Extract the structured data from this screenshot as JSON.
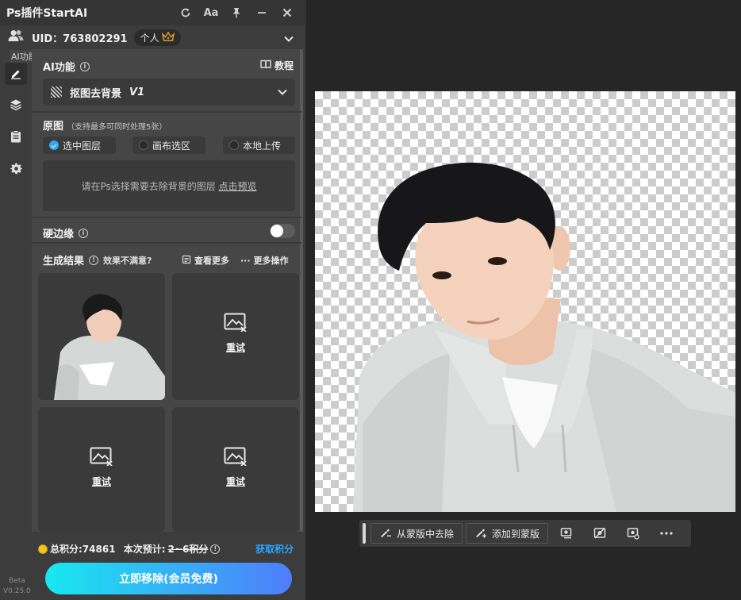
{
  "titlebar": {
    "title": "Ps插件StartAI",
    "icons": [
      "refresh-icon",
      "font-size-icon",
      "pin-icon",
      "minimize-icon",
      "close-icon"
    ],
    "font_label": "Aa"
  },
  "user": {
    "uid_label": "UID：763802291",
    "plan": "个人"
  },
  "sidebar": {
    "tooltip": "AI功能",
    "items": [
      "pen-icon",
      "layers-icon",
      "clipboard-icon",
      "gear-icon"
    ],
    "version_line1": "Beta",
    "version_line2": "V0.25.0"
  },
  "ai_function": {
    "title": "AI功能",
    "tutorial": "教程",
    "selected": "抠图去背景",
    "version": "V1"
  },
  "source": {
    "title": "原图",
    "hint": "（支持最多可同时处理5张）",
    "options": [
      "选中图层",
      "画布选区",
      "本地上传"
    ],
    "selected_index": 0,
    "drop_text": "请在Ps选择需要去除背景的图层",
    "preview_link": "点击预览"
  },
  "hard_edge": {
    "label": "硬边缘",
    "enabled": false
  },
  "results": {
    "title": "生成结果",
    "unsatisfied": "效果不满意?",
    "view_more": "查看更多",
    "more_actions": "更多操作",
    "retry_label": "重试"
  },
  "footer": {
    "total_points": "总积分:74861",
    "estimate_label": "本次预计:",
    "estimate_value": "2~6积分",
    "get_points": "获取积分",
    "cta": "立即移除(会员免费)"
  },
  "context_toolbar": {
    "remove_from_mask": "从蒙版中去除",
    "add_to_mask": "添加到蒙版"
  }
}
